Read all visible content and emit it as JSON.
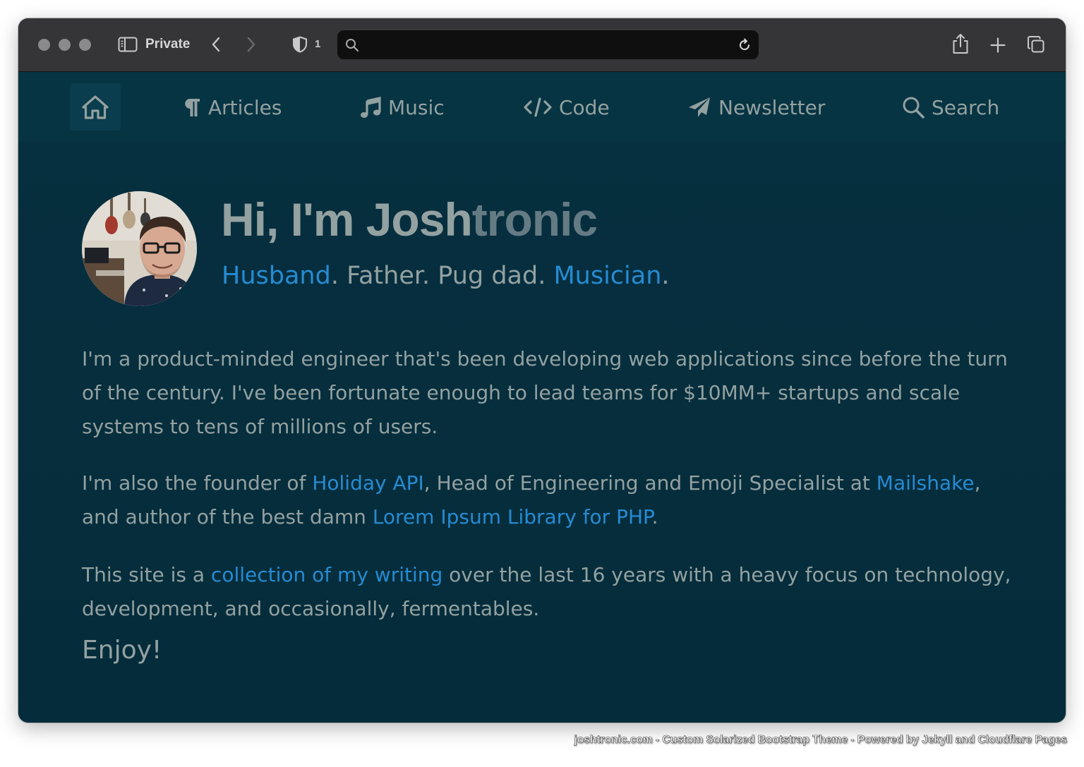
{
  "browser": {
    "private_label": "Private",
    "shield_count": "1",
    "address_value": "",
    "address_placeholder": "",
    "icons": [
      "sidebar-icon",
      "back-icon",
      "forward-icon",
      "shield-icon",
      "search-icon",
      "reload-icon",
      "share-icon",
      "new-tab-icon",
      "tabs-overview-icon"
    ]
  },
  "nav": {
    "home_icon": "home-icon",
    "items": [
      {
        "label": "Articles",
        "icon": "pilcrow-icon"
      },
      {
        "label": "Music",
        "icon": "music-note-icon"
      },
      {
        "label": "Code",
        "icon": "code-icon"
      },
      {
        "label": "Newsletter",
        "icon": "paper-plane-icon"
      },
      {
        "label": "Search",
        "icon": "search-icon"
      }
    ]
  },
  "hero": {
    "title_bright": "Hi, I'm Josh",
    "title_dim": "tronic",
    "tagline": {
      "link1": "Husband",
      "sep1": ". Father. Pug dad. ",
      "link2": "Musician",
      "end": "."
    }
  },
  "body": {
    "p1": "I'm a product-minded engineer that's been developing web applications since before the turn of the century. I've been fortunate enough to lead teams for $10MM+ startups and scale systems to tens of millions of users.",
    "p2": {
      "t1": "I'm also the founder of ",
      "link1": "Holiday API",
      "t2": ", Head of Engineering and Emoji Specialist at ",
      "link2": "Mailshake",
      "t3": ", and author of the best damn ",
      "link3": "Lorem Ipsum Library for PHP",
      "t4": "."
    },
    "p3": {
      "t1": "This site is a ",
      "link1": "collection of my writing",
      "t2": " over the last 16 years with a heavy focus on technology, development, and occasionally, fermentables."
    },
    "enjoy": "Enjoy!"
  },
  "caption": "joshtronic.com - Custom Solarized Bootstrap Theme - Powered by Jekyll and Cloudflare Pages",
  "colors": {
    "background": "#062c3b",
    "nav_background": "#073442",
    "text": "#93a1a1",
    "title_dim": "#657b83",
    "link": "#268bd2",
    "toolbar": "#353537"
  }
}
